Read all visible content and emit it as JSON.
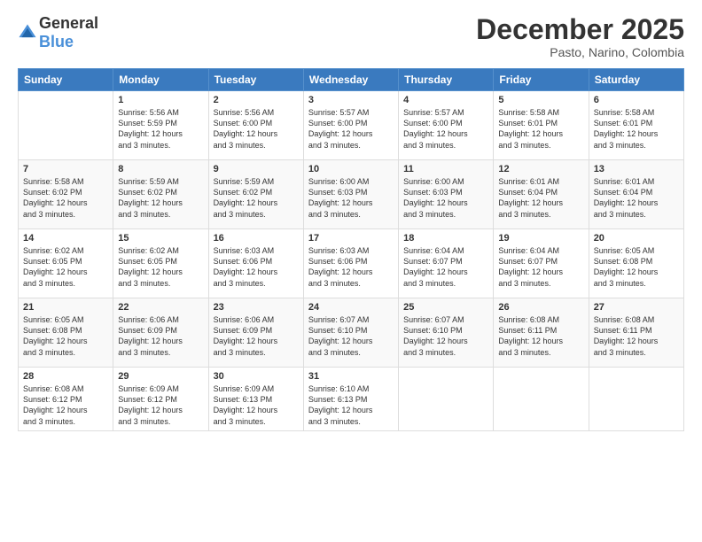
{
  "header": {
    "logo_general": "General",
    "logo_blue": "Blue",
    "month": "December 2025",
    "location": "Pasto, Narino, Colombia"
  },
  "weekdays": [
    "Sunday",
    "Monday",
    "Tuesday",
    "Wednesday",
    "Thursday",
    "Friday",
    "Saturday"
  ],
  "weeks": [
    [
      {
        "day": "",
        "info": ""
      },
      {
        "day": "1",
        "info": "Sunrise: 5:56 AM\nSunset: 5:59 PM\nDaylight: 12 hours\nand 3 minutes."
      },
      {
        "day": "2",
        "info": "Sunrise: 5:56 AM\nSunset: 6:00 PM\nDaylight: 12 hours\nand 3 minutes."
      },
      {
        "day": "3",
        "info": "Sunrise: 5:57 AM\nSunset: 6:00 PM\nDaylight: 12 hours\nand 3 minutes."
      },
      {
        "day": "4",
        "info": "Sunrise: 5:57 AM\nSunset: 6:00 PM\nDaylight: 12 hours\nand 3 minutes."
      },
      {
        "day": "5",
        "info": "Sunrise: 5:58 AM\nSunset: 6:01 PM\nDaylight: 12 hours\nand 3 minutes."
      },
      {
        "day": "6",
        "info": "Sunrise: 5:58 AM\nSunset: 6:01 PM\nDaylight: 12 hours\nand 3 minutes."
      }
    ],
    [
      {
        "day": "7",
        "info": "Sunrise: 5:58 AM\nSunset: 6:02 PM\nDaylight: 12 hours\nand 3 minutes."
      },
      {
        "day": "8",
        "info": "Sunrise: 5:59 AM\nSunset: 6:02 PM\nDaylight: 12 hours\nand 3 minutes."
      },
      {
        "day": "9",
        "info": "Sunrise: 5:59 AM\nSunset: 6:02 PM\nDaylight: 12 hours\nand 3 minutes."
      },
      {
        "day": "10",
        "info": "Sunrise: 6:00 AM\nSunset: 6:03 PM\nDaylight: 12 hours\nand 3 minutes."
      },
      {
        "day": "11",
        "info": "Sunrise: 6:00 AM\nSunset: 6:03 PM\nDaylight: 12 hours\nand 3 minutes."
      },
      {
        "day": "12",
        "info": "Sunrise: 6:01 AM\nSunset: 6:04 PM\nDaylight: 12 hours\nand 3 minutes."
      },
      {
        "day": "13",
        "info": "Sunrise: 6:01 AM\nSunset: 6:04 PM\nDaylight: 12 hours\nand 3 minutes."
      }
    ],
    [
      {
        "day": "14",
        "info": "Sunrise: 6:02 AM\nSunset: 6:05 PM\nDaylight: 12 hours\nand 3 minutes."
      },
      {
        "day": "15",
        "info": "Sunrise: 6:02 AM\nSunset: 6:05 PM\nDaylight: 12 hours\nand 3 minutes."
      },
      {
        "day": "16",
        "info": "Sunrise: 6:03 AM\nSunset: 6:06 PM\nDaylight: 12 hours\nand 3 minutes."
      },
      {
        "day": "17",
        "info": "Sunrise: 6:03 AM\nSunset: 6:06 PM\nDaylight: 12 hours\nand 3 minutes."
      },
      {
        "day": "18",
        "info": "Sunrise: 6:04 AM\nSunset: 6:07 PM\nDaylight: 12 hours\nand 3 minutes."
      },
      {
        "day": "19",
        "info": "Sunrise: 6:04 AM\nSunset: 6:07 PM\nDaylight: 12 hours\nand 3 minutes."
      },
      {
        "day": "20",
        "info": "Sunrise: 6:05 AM\nSunset: 6:08 PM\nDaylight: 12 hours\nand 3 minutes."
      }
    ],
    [
      {
        "day": "21",
        "info": "Sunrise: 6:05 AM\nSunset: 6:08 PM\nDaylight: 12 hours\nand 3 minutes."
      },
      {
        "day": "22",
        "info": "Sunrise: 6:06 AM\nSunset: 6:09 PM\nDaylight: 12 hours\nand 3 minutes."
      },
      {
        "day": "23",
        "info": "Sunrise: 6:06 AM\nSunset: 6:09 PM\nDaylight: 12 hours\nand 3 minutes."
      },
      {
        "day": "24",
        "info": "Sunrise: 6:07 AM\nSunset: 6:10 PM\nDaylight: 12 hours\nand 3 minutes."
      },
      {
        "day": "25",
        "info": "Sunrise: 6:07 AM\nSunset: 6:10 PM\nDaylight: 12 hours\nand 3 minutes."
      },
      {
        "day": "26",
        "info": "Sunrise: 6:08 AM\nSunset: 6:11 PM\nDaylight: 12 hours\nand 3 minutes."
      },
      {
        "day": "27",
        "info": "Sunrise: 6:08 AM\nSunset: 6:11 PM\nDaylight: 12 hours\nand 3 minutes."
      }
    ],
    [
      {
        "day": "28",
        "info": "Sunrise: 6:08 AM\nSunset: 6:12 PM\nDaylight: 12 hours\nand 3 minutes."
      },
      {
        "day": "29",
        "info": "Sunrise: 6:09 AM\nSunset: 6:12 PM\nDaylight: 12 hours\nand 3 minutes."
      },
      {
        "day": "30",
        "info": "Sunrise: 6:09 AM\nSunset: 6:13 PM\nDaylight: 12 hours\nand 3 minutes."
      },
      {
        "day": "31",
        "info": "Sunrise: 6:10 AM\nSunset: 6:13 PM\nDaylight: 12 hours\nand 3 minutes."
      },
      {
        "day": "",
        "info": ""
      },
      {
        "day": "",
        "info": ""
      },
      {
        "day": "",
        "info": ""
      }
    ]
  ]
}
